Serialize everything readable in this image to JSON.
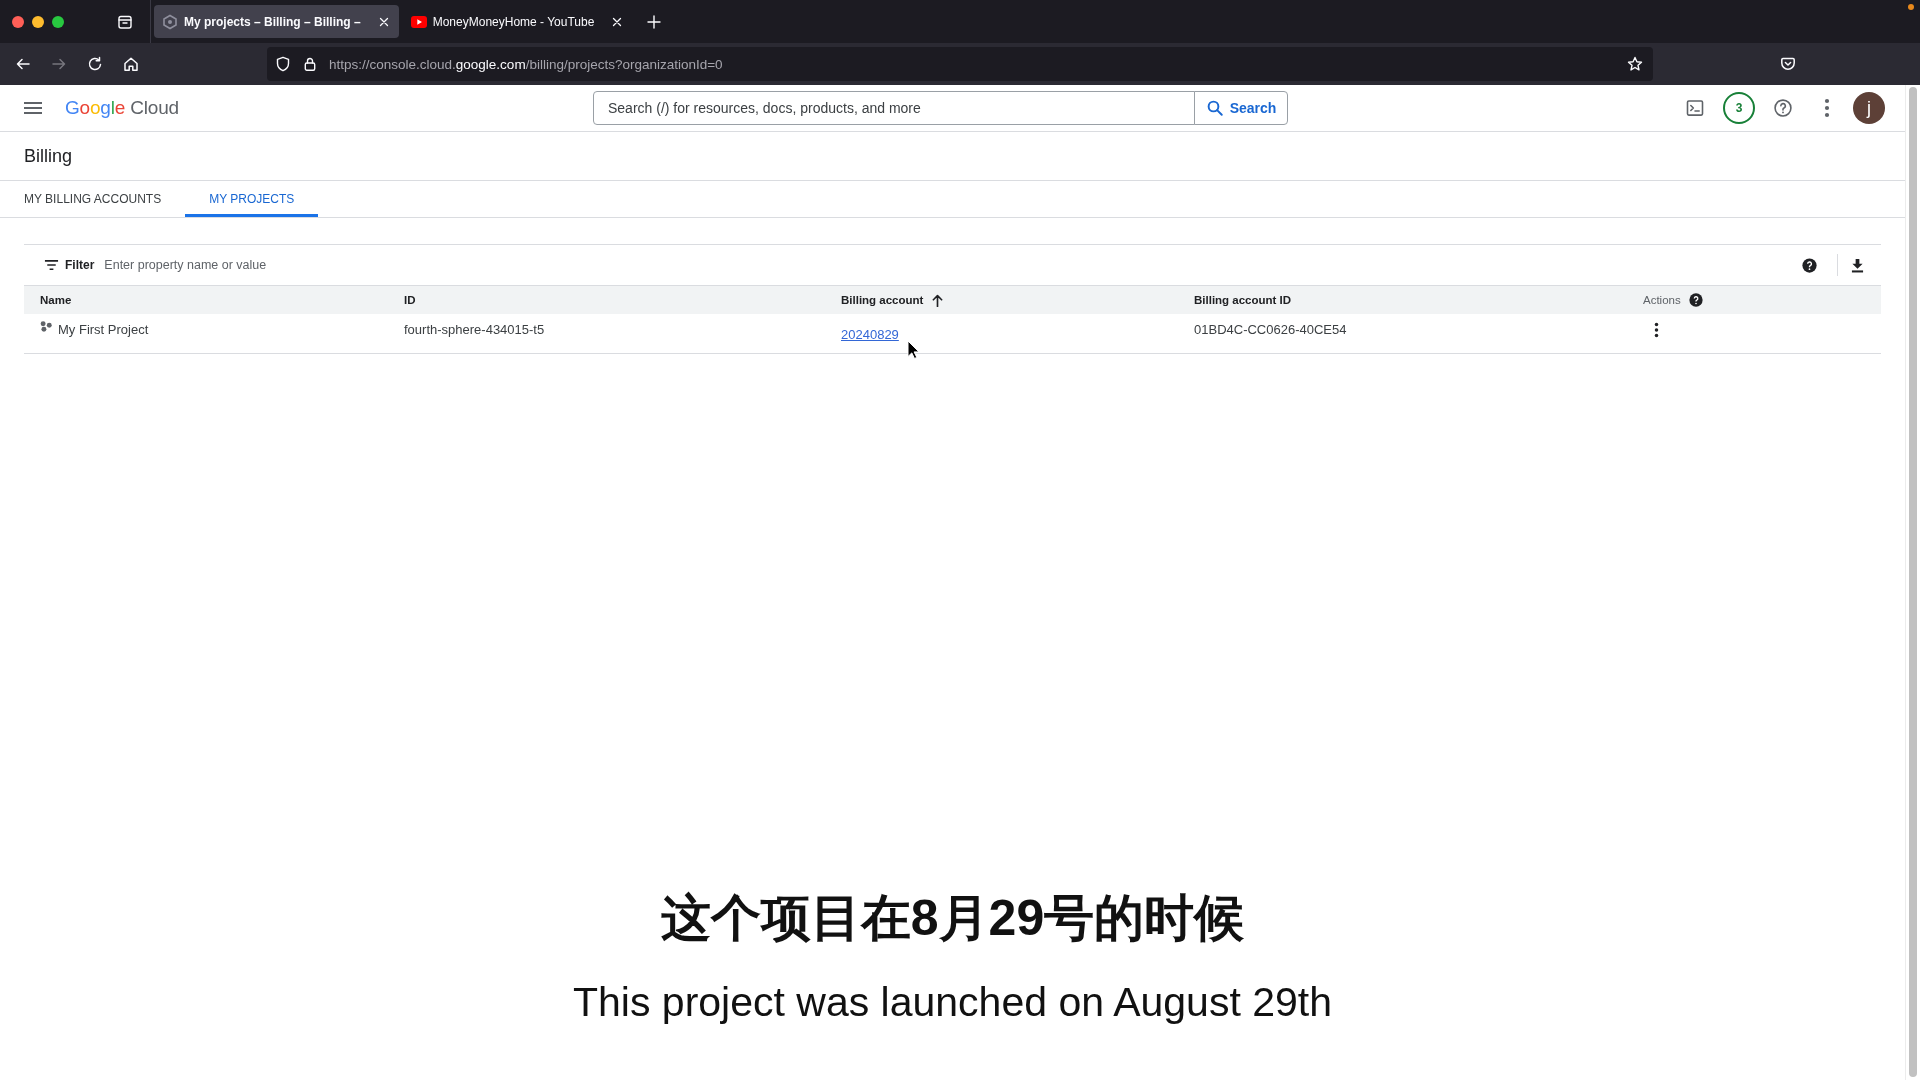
{
  "browser": {
    "tabs": [
      {
        "title": "My projects – Billing – Billing –",
        "kind": "hexagon",
        "selected": true
      },
      {
        "title": "MoneyMoneyHome - YouTube",
        "kind": "play",
        "selected": false
      }
    ],
    "nav": [
      {
        "kind": "back",
        "disabled": false
      },
      {
        "kind": "forward",
        "disabled": true
      },
      {
        "kind": "reload",
        "disabled": false
      },
      {
        "kind": "home",
        "disabled": false
      }
    ],
    "url": "https://console.cloud.**google.com**/billing/projects?organizationId=0"
  },
  "header": {
    "logo": {
      "brand": "Google",
      "product": "Cloud"
    },
    "search": {
      "placeholder": "Search (/) for resources, docs, products, and more",
      "button": "Search"
    },
    "task_count": "3",
    "avatar": "j"
  },
  "page_title": "Billing",
  "tabs": [
    {
      "label": "MY BILLING ACCOUNTS",
      "selected": false
    },
    {
      "label": "MY PROJECTS",
      "selected": true
    }
  ],
  "filter": {
    "label": "Filter",
    "placeholder": "Enter property name or value"
  },
  "table": {
    "columns": [
      {
        "label": "Name",
        "kind": "project",
        "sorted": false
      },
      {
        "label": "ID",
        "kind": "text",
        "sorted": false
      },
      {
        "label": "Billing account",
        "kind": "link",
        "sorted": true
      },
      {
        "label": "Billing account ID",
        "kind": "text",
        "sorted": false
      },
      {
        "label": "Actions",
        "kind": "actions",
        "sorted": false
      }
    ],
    "rows": [
      {
        "cells": [
          "My First Project",
          "fourth-sphere-434015-t5",
          "20240829",
          "01BD4C-CC0626-40CE54"
        ]
      }
    ]
  },
  "subtitles": [
    {
      "kind": "chinese",
      "text": "这个项目在8月29号的时候"
    },
    {
      "kind": "english",
      "text": "This project was launched on August 29th"
    }
  ]
}
